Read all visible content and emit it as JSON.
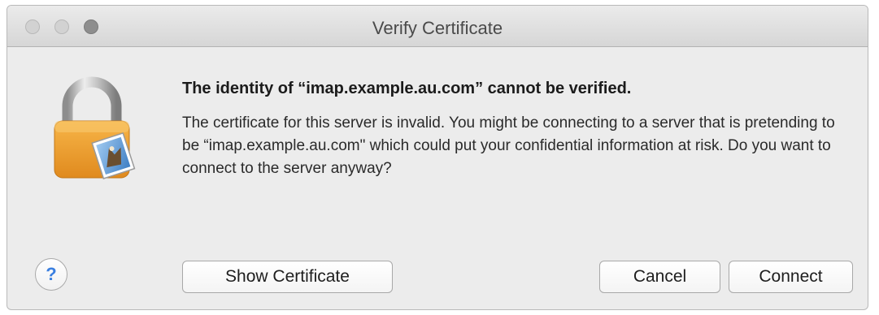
{
  "window": {
    "title": "Verify Certificate"
  },
  "dialog": {
    "heading": "The identity of “imap.example.au.com” cannot be verified.",
    "message": "The certificate for this server is invalid. You might be connecting to a server that is pretending to be “imap.example.au.com\" which could put your confidential information at risk. Do you want to connect to the server anyway?",
    "icon": "lock-with-mail-stamp-icon"
  },
  "buttons": {
    "help_label": "?",
    "show_certificate_label": "Show Certificate",
    "cancel_label": "Cancel",
    "connect_label": "Connect"
  },
  "colors": {
    "lock_body": "#f0a23a",
    "help_accent": "#3a7fe0"
  }
}
